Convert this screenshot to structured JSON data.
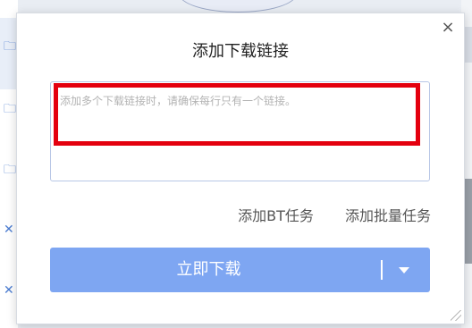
{
  "dialog": {
    "title": "添加下载链接",
    "close_label": "×",
    "link_input": {
      "placeholder": "添加多个下载链接时，请确保每行只有一个链接。",
      "value": ""
    },
    "actions": {
      "add_bt": "添加BT任务",
      "add_batch": "添加批量任务"
    },
    "download_button": {
      "label": "立即下载",
      "menu_icon": "chevron-down-icon"
    },
    "colors": {
      "primary_button": "#7ea6f2",
      "highlight_box": "#e4000f"
    }
  },
  "background": {
    "left_icons": [
      "folder-icon",
      "folder-icon",
      "folder-icon",
      "close-icon",
      "close-icon"
    ]
  }
}
